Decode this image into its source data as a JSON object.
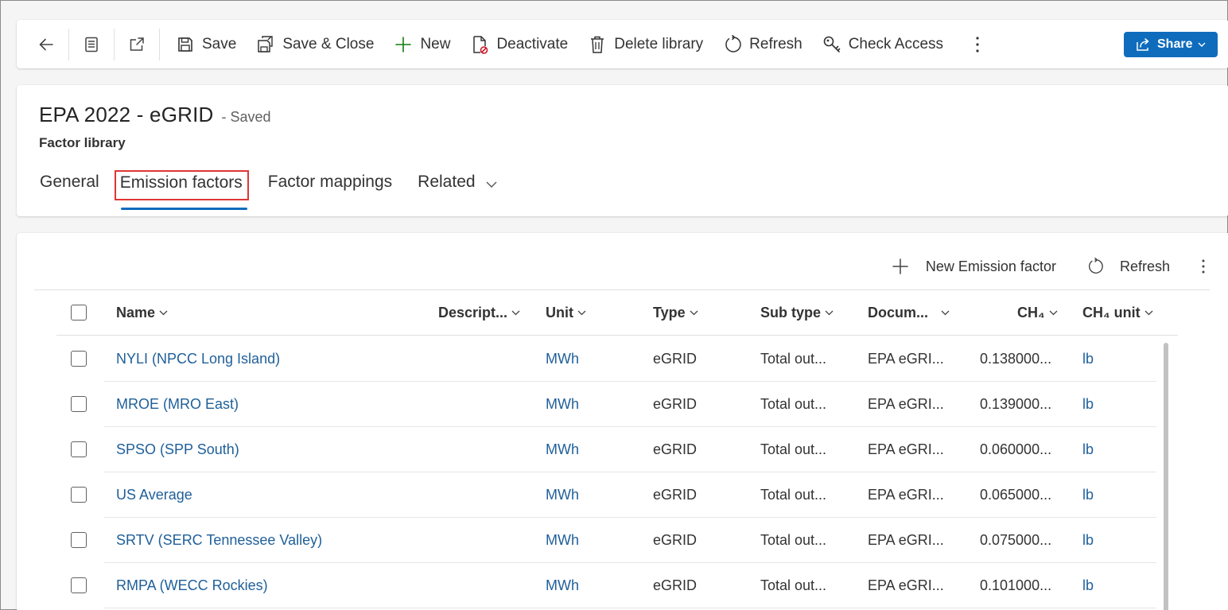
{
  "toolbar": {
    "save": "Save",
    "save_close": "Save & Close",
    "new": "New",
    "deactivate": "Deactivate",
    "delete_library": "Delete library",
    "refresh": "Refresh",
    "check_access": "Check Access",
    "share": "Share"
  },
  "header": {
    "title": "EPA 2022 - eGRID",
    "saved_status": "- Saved",
    "entity_type": "Factor library"
  },
  "tabs": [
    {
      "label": "General"
    },
    {
      "label": "Emission factors",
      "active": true
    },
    {
      "label": "Factor mappings"
    },
    {
      "label": "Related"
    }
  ],
  "subgrid": {
    "new_label": "New Emission factor",
    "refresh_label": "Refresh",
    "columns": {
      "name": "Name",
      "description": "Descript...",
      "unit": "Unit",
      "type": "Type",
      "subtype": "Sub type",
      "document": "Docum...",
      "ch4": "CH₄",
      "ch4_unit": "CH₄ unit"
    },
    "rows": [
      {
        "name": "NYLI (NPCC Long Island)",
        "unit": "MWh",
        "type": "eGRID",
        "subtype": "Total out...",
        "document": "EPA eGRI...",
        "ch4": "0.138000...",
        "ch4_unit": "lb"
      },
      {
        "name": "MROE (MRO East)",
        "unit": "MWh",
        "type": "eGRID",
        "subtype": "Total out...",
        "document": "EPA eGRI...",
        "ch4": "0.139000...",
        "ch4_unit": "lb"
      },
      {
        "name": "SPSO (SPP South)",
        "unit": "MWh",
        "type": "eGRID",
        "subtype": "Total out...",
        "document": "EPA eGRI...",
        "ch4": "0.060000...",
        "ch4_unit": "lb"
      },
      {
        "name": "US Average",
        "unit": "MWh",
        "type": "eGRID",
        "subtype": "Total out...",
        "document": "EPA eGRI...",
        "ch4": "0.065000...",
        "ch4_unit": "lb"
      },
      {
        "name": "SRTV (SERC Tennessee Valley)",
        "unit": "MWh",
        "type": "eGRID",
        "subtype": "Total out...",
        "document": "EPA eGRI...",
        "ch4": "0.075000...",
        "ch4_unit": "lb"
      },
      {
        "name": "RMPA (WECC Rockies)",
        "unit": "MWh",
        "type": "eGRID",
        "subtype": "Total out...",
        "document": "EPA eGRI...",
        "ch4": "0.101000...",
        "ch4_unit": "lb"
      }
    ]
  },
  "colors": {
    "accent": "#0f6cbd",
    "link": "#1f5f99",
    "tab_highlight": "#e03535",
    "new_plus": "#107c10"
  }
}
